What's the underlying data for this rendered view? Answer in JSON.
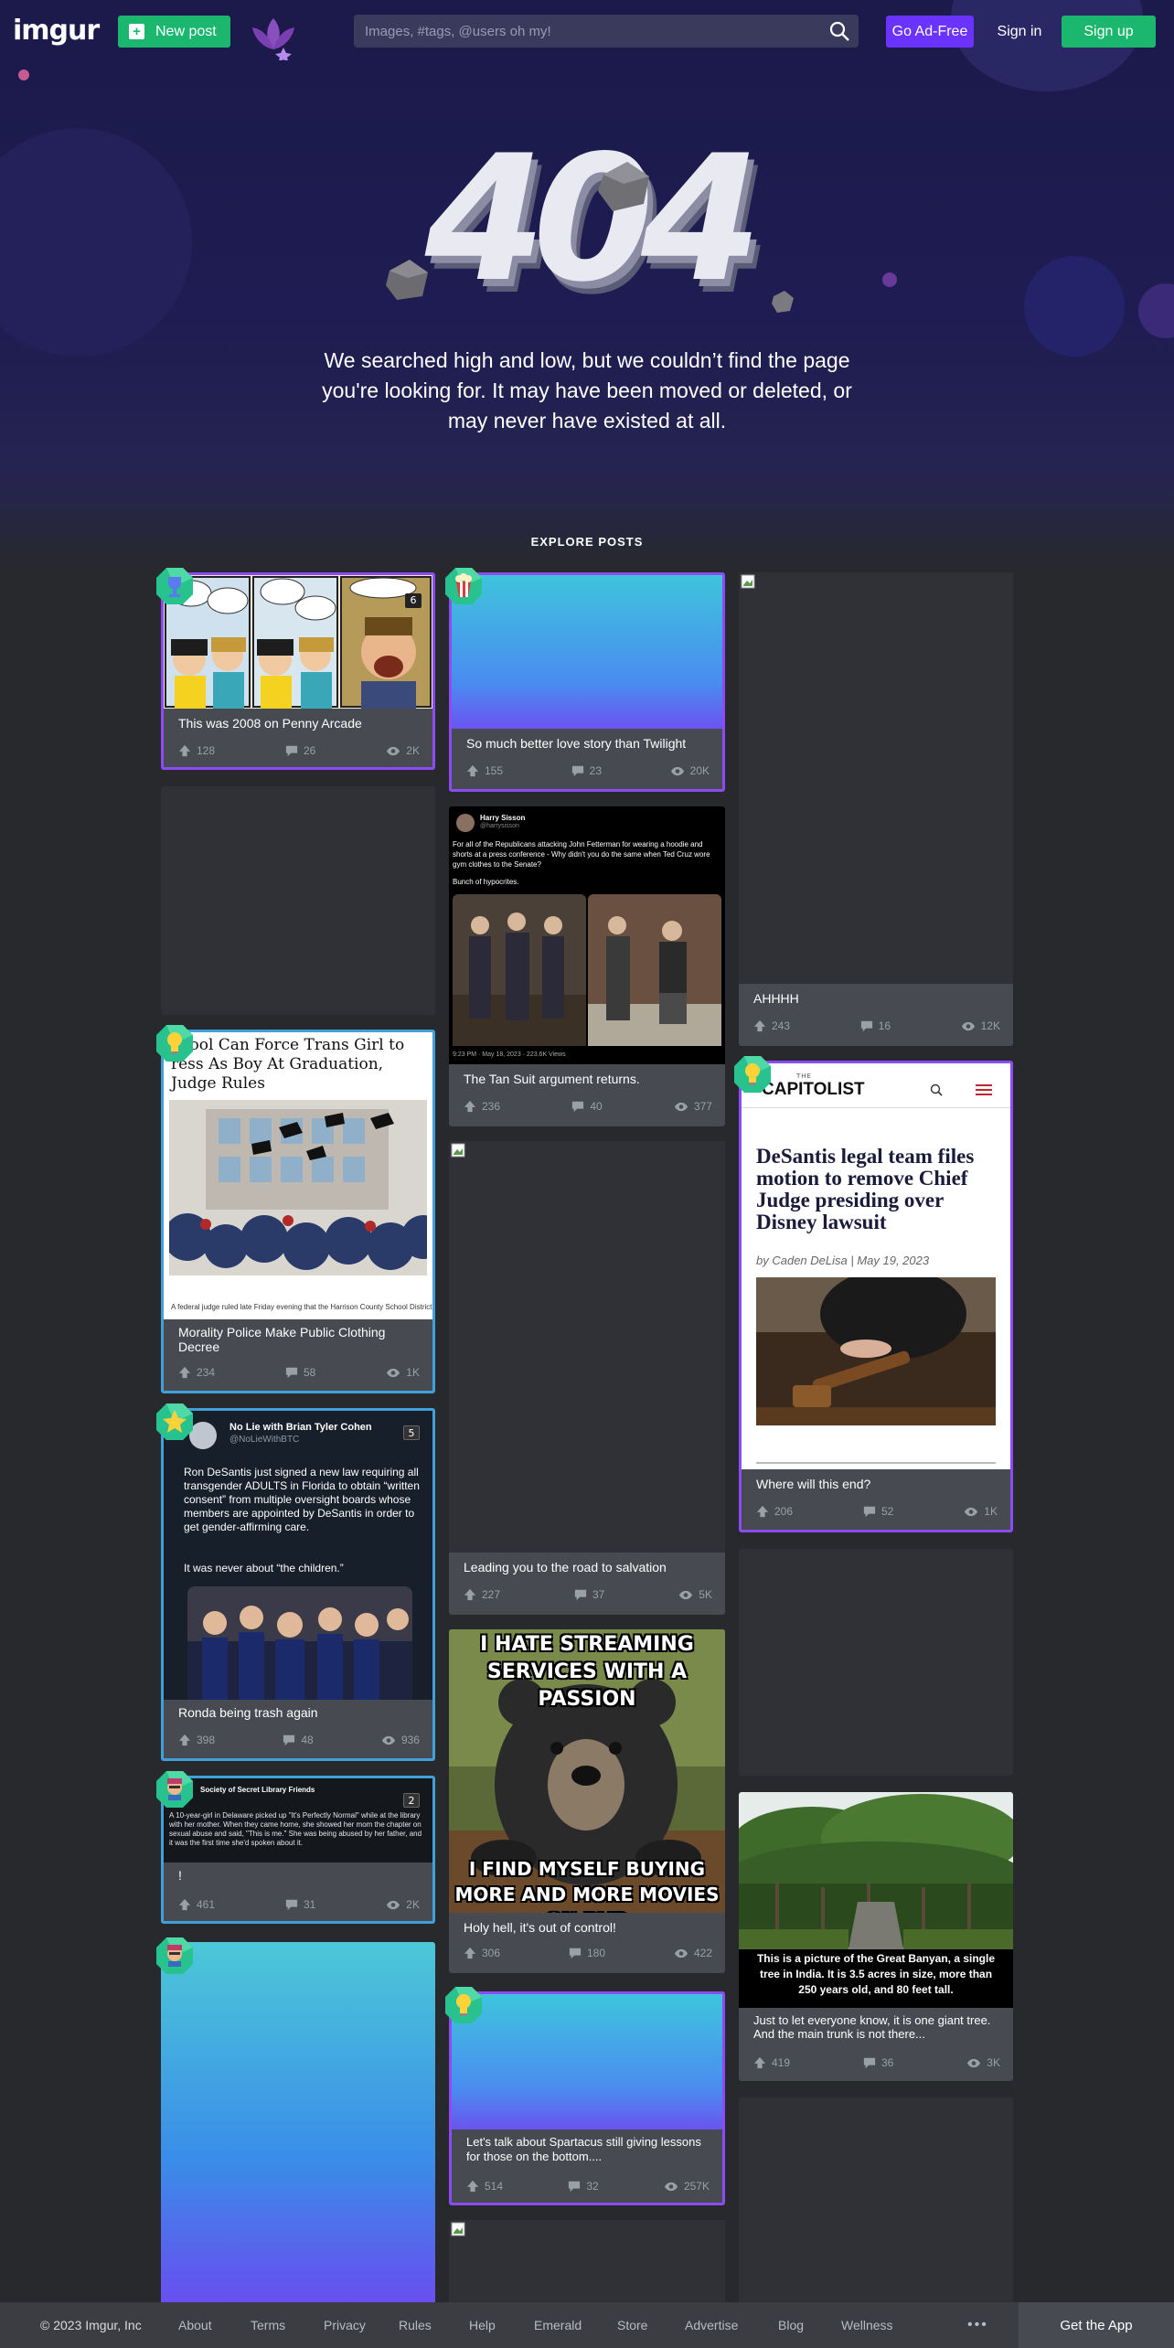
{
  "header": {
    "logo_text": "imgur",
    "new_post_label": "New post",
    "search_placeholder": "Images, #tags, @users oh my!",
    "ad_free_label": "Go Ad-Free",
    "sign_in_label": "Sign in",
    "sign_up_label": "Sign up"
  },
  "error": {
    "code": "404",
    "message": "We searched high and low, but we couldn’t find the page you're looking for. It may have been moved or deleted, or may never have existed at all."
  },
  "explore_label": "EXPLORE POSTS",
  "posts": [
    {
      "title": "This was 2008 on Penny Arcade",
      "upvotes": "128",
      "comments": "26",
      "views": "2K",
      "media_text": "6"
    },
    {
      "title": "So much better love story than Twilight",
      "upvotes": "155",
      "comments": "23",
      "views": "20K"
    },
    {
      "title": "AHHHH",
      "upvotes": "243",
      "comments": "16",
      "views": "12K"
    },
    {
      "title": "The Tan Suit argument returns.",
      "upvotes": "236",
      "comments": "40",
      "views": "377",
      "tweet": {
        "name": "Harry Sisson",
        "handle": "@harrysisson",
        "text": "For all of the Republicans attacking John Fetterman for wearing a hoodie and shorts at a press conference - Why didn't you do the same when Ted Cruz wore gym clothes to the Senate?",
        "text2": "Bunch of hypocrites.",
        "meta": "9:23 PM · May 18, 2023 · 223.6K Views"
      }
    },
    {
      "title": "Morality Police Make Public Clothing Decree",
      "upvotes": "234",
      "comments": "58",
      "views": "1K",
      "headline": "chool Can Force Trans Girl to ress As Boy At Graduation, Judge Rules",
      "caption": "A federal judge ruled late Friday evening that the Harrison County School District can prohibit a"
    },
    {
      "title": "Where will this end?",
      "upvotes": "206",
      "comments": "52",
      "views": "1K",
      "article": {
        "kicker": "THE",
        "brand": "CAPITOLIST",
        "headline": "DeSantis legal team files motion to remove Chief Judge presiding over Disney lawsuit",
        "byline": "by Caden DeLisa | May 19, 2023"
      }
    },
    {
      "title": "Ronda being trash again",
      "upvotes": "398",
      "comments": "48",
      "views": "936",
      "tweet": {
        "name": "No Lie with Brian Tyler Cohen",
        "handle": "@NoLieWithBTC",
        "count": "5",
        "text": "Ron DeSantis just signed a new law requiring all transgender ADULTS in Florida to obtain “written consent” from multiple oversight boards whose members are appointed by DeSantis in order to get gender-affirming care.",
        "text2": "It was never about “the children.”"
      }
    },
    {
      "title": "Leading you to the road to salvation",
      "upvotes": "227",
      "comments": "37",
      "views": "5K"
    },
    {
      "title": "!",
      "upvotes": "461",
      "comments": "31",
      "views": "2K",
      "tweet": {
        "name": "Society of Secret Library Friends",
        "count": "2",
        "text": "A 10-year-girl in Delaware picked up \"It's Perfectly Normal\" while at the library with her mother. When they came home, she showed her mom the chapter on sexual abuse and said, \"This is me.\" She was being abused by her father, and it was the first time she'd spoken about it."
      }
    },
    {
      "title": "Holy hell, it's out of control!",
      "upvotes": "306",
      "comments": "180",
      "views": "422",
      "meme_top": "I HATE STREAMING SERVICES WITH A PASSION",
      "meme_bottom": "I FIND MYSELF BUYING MORE AND MORE MOVIES ON DVD"
    },
    {
      "title": "Just to let everyone know, it is one giant tree. And the main trunk is not there...",
      "upvotes": "419",
      "comments": "36",
      "views": "3K",
      "photo_caption": "This is a picture of the Great Banyan, a single tree in India. It is 3.5 acres in size, more than 250 years old, and 80 feet tall."
    },
    {
      "title": "Let's talk about Spartacus still giving lessons for those on the bottom....",
      "upvotes": "514",
      "comments": "32",
      "views": "257K"
    }
  ],
  "footer": {
    "copyright": "© 2023 Imgur, Inc",
    "links": [
      "About",
      "Terms",
      "Privacy",
      "Rules",
      "Help",
      "Emerald",
      "Store",
      "Advertise",
      "Blog",
      "Wellness"
    ],
    "more": "•••",
    "get_app": "Get the App"
  },
  "colors": {
    "brand_green": "#1bb76e",
    "ad_free_purple": "#6a33ff",
    "promo_border_purple": "#8c4bf4",
    "promo_border_blue": "#3fa1d8",
    "hero_bg": "#1b1a4a",
    "page_bg": "#27292d"
  },
  "icons": [
    "plus-icon",
    "lotus-icon",
    "search-icon",
    "upvote-icon",
    "comment-icon",
    "views-icon",
    "emerald-badge-icon",
    "popcorn-badge-icon",
    "trophy-badge-icon",
    "lightbulb-badge-icon",
    "star-badge-icon",
    "avatar-badge-icon"
  ]
}
